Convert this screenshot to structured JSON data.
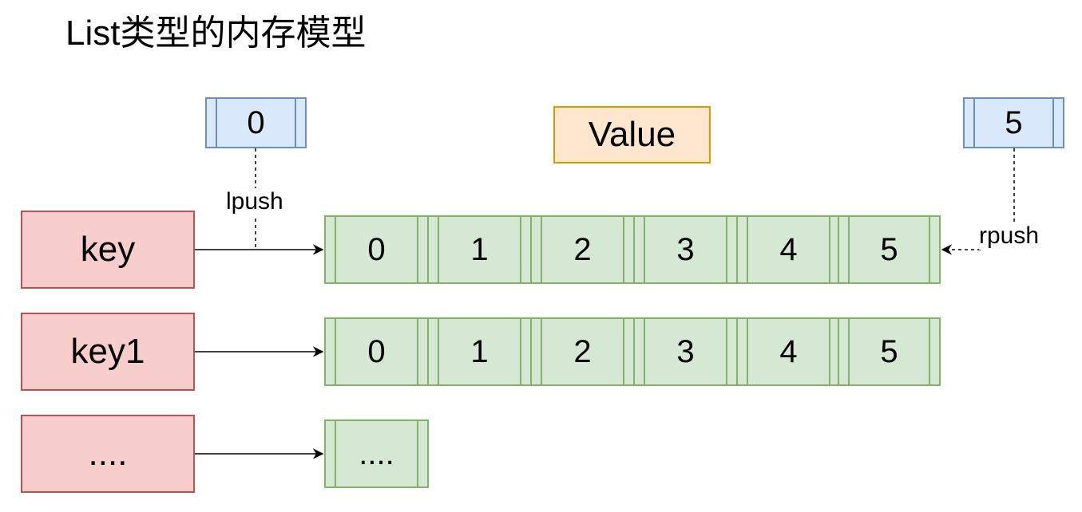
{
  "title": "List类型的内存模型",
  "value_label": "Value",
  "left_index": "0",
  "right_index": "5",
  "lpush_label": "lpush",
  "rpush_label": "rpush",
  "keys": [
    "key",
    "key1",
    "...."
  ],
  "lists": [
    [
      "0",
      "1",
      "2",
      "3",
      "4",
      "5"
    ],
    [
      "0",
      "1",
      "2",
      "3",
      "4",
      "5"
    ],
    [
      "...."
    ]
  ],
  "colors": {
    "key_fill": "#f8cecc",
    "key_stroke": "#b85450",
    "cell_fill": "#d5e8d4",
    "cell_stroke": "#82b366",
    "index_fill": "#dae8fc",
    "index_stroke": "#6c8ebf",
    "value_fill": "#ffe6cc",
    "value_stroke": "#d79b00"
  }
}
